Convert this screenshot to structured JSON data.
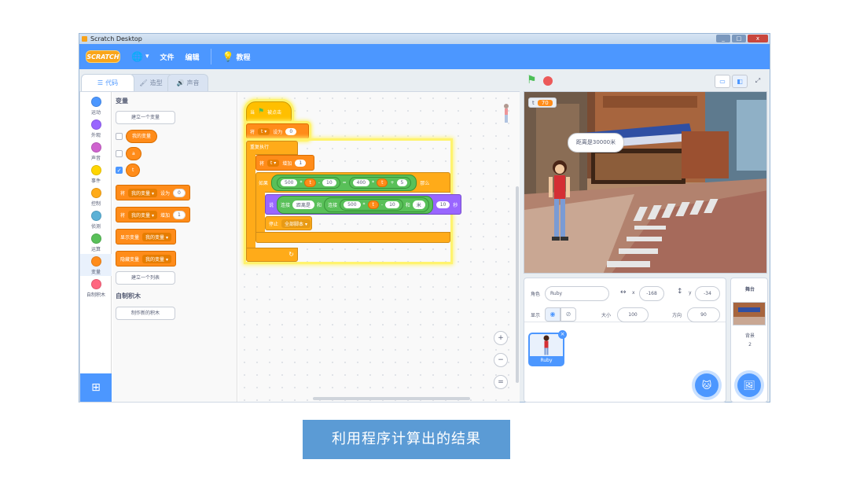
{
  "window": {
    "title": "Scratch Desktop",
    "buttons": [
      "_",
      "□",
      "x"
    ]
  },
  "menubar": {
    "logo": "SCRATCH",
    "language_icon": "globe-icon",
    "file": "文件",
    "edit": "编辑",
    "tutorial": "教程"
  },
  "tabs": {
    "code": "代码",
    "costumes": "造型",
    "sounds": "声音"
  },
  "categories": [
    {
      "label": "运动",
      "color": "#4c97ff"
    },
    {
      "label": "外观",
      "color": "#9966ff"
    },
    {
      "label": "声音",
      "color": "#cf63cf"
    },
    {
      "label": "事件",
      "color": "#ffd500"
    },
    {
      "label": "控制",
      "color": "#ffab19"
    },
    {
      "label": "侦测",
      "color": "#5cb1d6"
    },
    {
      "label": "运算",
      "color": "#59c059"
    },
    {
      "label": "变量",
      "color": "#ff8c1a"
    },
    {
      "label": "自制积木",
      "color": "#ff6680"
    }
  ],
  "palette": {
    "variables_title": "变量",
    "make_variable": "建立一个变量",
    "vars": [
      "我的变量",
      "a",
      "t"
    ],
    "set_block": {
      "prefix": "将",
      "var": "我的变量",
      "mid": "设为",
      "value": "0"
    },
    "change_block": {
      "prefix": "将",
      "var": "我的变量",
      "mid": "增加",
      "value": "1"
    },
    "show_block": {
      "prefix": "显示变量",
      "var": "我的变量"
    },
    "hide_block": {
      "prefix": "隐藏变量",
      "var": "我的变量"
    },
    "make_list": "建立一个列表",
    "my_blocks_title": "自制积木",
    "make_block": "制作新的积木"
  },
  "script": {
    "hat": {
      "prefix": "当",
      "suffix": "被点击"
    },
    "set": {
      "prefix": "将",
      "var": "t",
      "mid": "设为",
      "value": "0"
    },
    "repeat": "重复执行",
    "change": {
      "prefix": "将",
      "var": "t",
      "mid": "增加",
      "value": "1"
    },
    "if": {
      "label": "如果",
      "n1": "500",
      "op1": "*",
      "v1": "t",
      "op2": "-",
      "n2": "10",
      "eq": "=",
      "n3": "400",
      "op3": "*",
      "v2": "t",
      "op4": "+",
      "n4": "5",
      "then": "那么"
    },
    "say": {
      "label": "说",
      "join": "连接",
      "text": "距离是",
      "and": "和",
      "join2": "连接",
      "n1": "500",
      "op1": "*",
      "v1": "t",
      "op2": "-",
      "n2": "10",
      "and2": "和",
      "unit": "米",
      "secs": "10",
      "secs_label": "秒"
    },
    "stop": {
      "label": "停止",
      "option": "全部脚本"
    }
  },
  "zoom": {
    "in": "+",
    "out": "−",
    "reset": "="
  },
  "stage": {
    "monitor_name": "t",
    "monitor_value": "70",
    "speech": "距离是30000米"
  },
  "sprite_info": {
    "sprite_label": "角色",
    "sprite_name": "Ruby",
    "x_label": "x",
    "x_value": "-168",
    "y_label": "y",
    "y_value": "-34",
    "show_label": "显示",
    "size_label": "大小",
    "size_value": "100",
    "direction_label": "方向",
    "direction_value": "90"
  },
  "sprite_list": [
    {
      "name": "Ruby"
    }
  ],
  "stage_panel": {
    "title": "舞台",
    "backdrops_label": "背景",
    "backdrops_count": "2"
  },
  "caption": "利用程序计算出的结果"
}
